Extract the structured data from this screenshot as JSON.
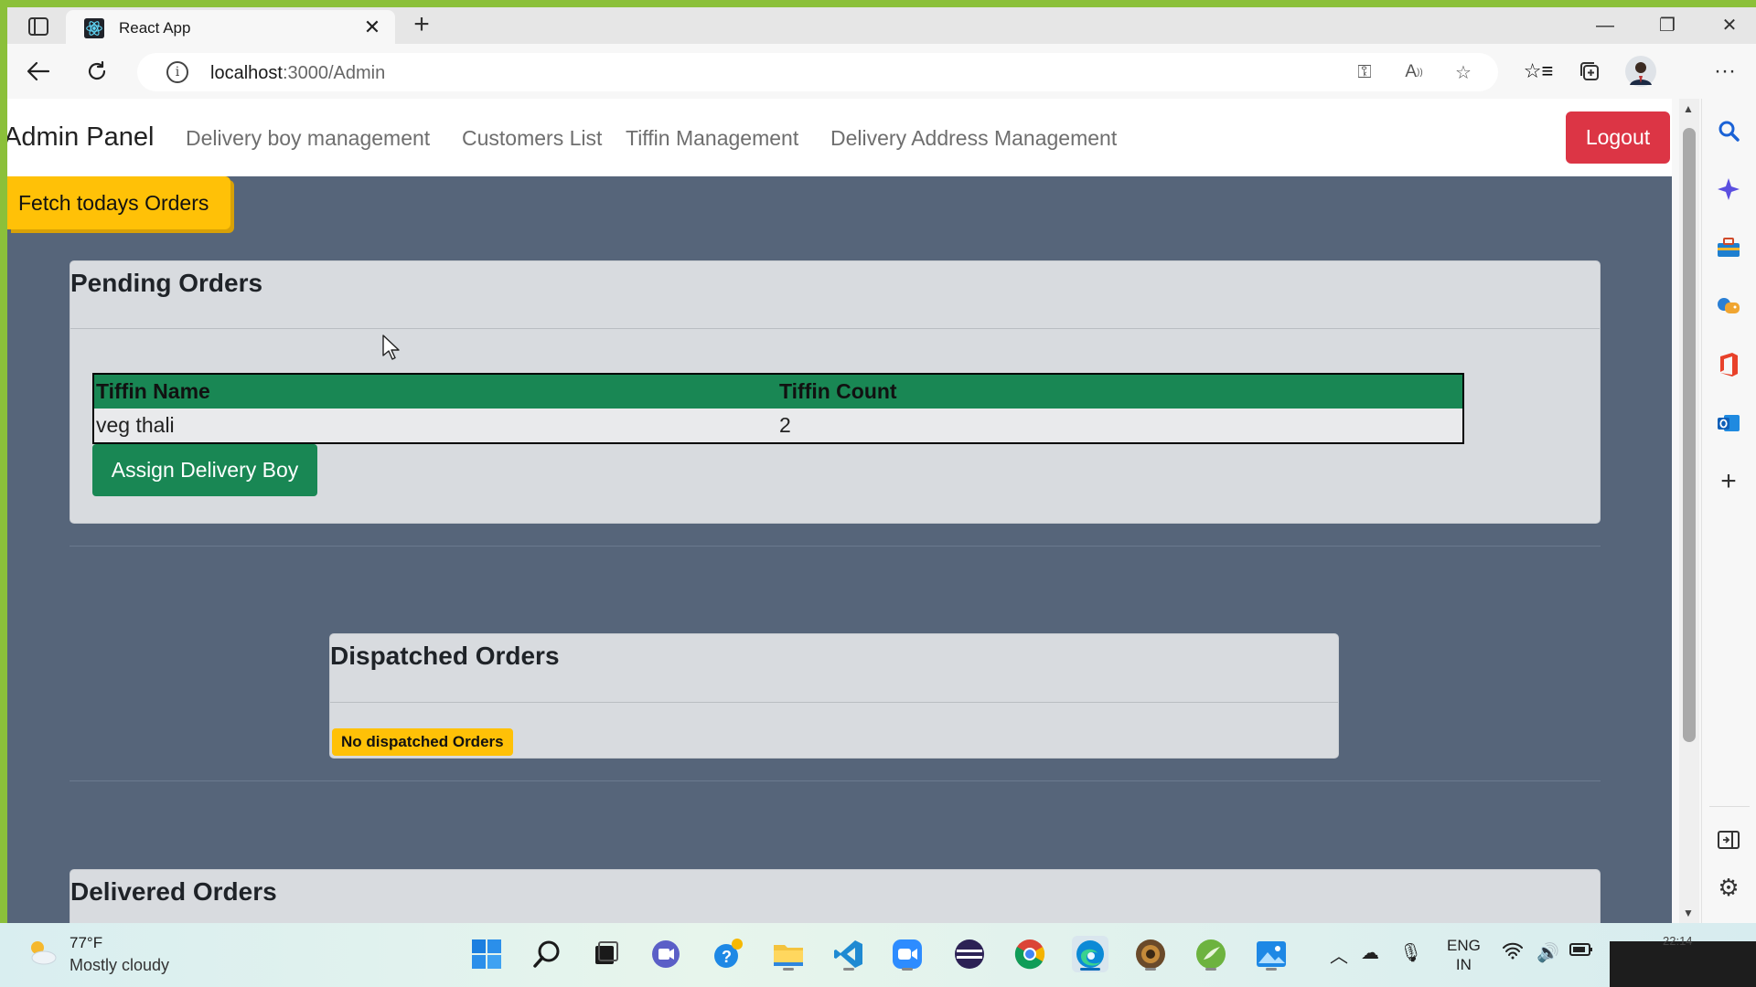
{
  "browser": {
    "tab_title": "React App",
    "url_host": "localhost",
    "url_path": ":3000/Admin"
  },
  "navbar": {
    "brand": "Admin Panel",
    "links": [
      "Delivery boy management",
      "Customers List",
      "Tiffin Management",
      "Delivery Address Management"
    ],
    "logout_label": "Logout"
  },
  "fetch_button_label": "Fetch todays Orders",
  "pending": {
    "title": "Pending Orders",
    "columns": [
      "Tiffin Name",
      "Tiffin Count"
    ],
    "rows": [
      [
        "veg thali",
        "2"
      ]
    ],
    "assign_label": "Assign Delivery Boy"
  },
  "dispatched": {
    "title": "Dispatched Orders",
    "empty_badge": "No dispatched Orders"
  },
  "delivered": {
    "title": "Delivered Orders"
  },
  "taskbar": {
    "weather_temp": "77°F",
    "weather_desc": "Mostly cloudy",
    "lang_line1": "ENG",
    "lang_line2": "IN",
    "clock_partial": "22:14"
  },
  "colors": {
    "page_bg": "#56657a",
    "success": "#198754",
    "warning": "#ffc107",
    "danger": "#dc3545"
  },
  "icons": {
    "sidebar": [
      "search-icon",
      "copilot-icon",
      "tools-icon",
      "games-icon",
      "office-icon",
      "outlook-icon",
      "add-icon",
      "split-screen-icon",
      "settings-icon"
    ]
  }
}
